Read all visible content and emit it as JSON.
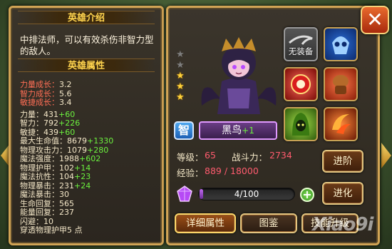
{
  "hero_info": {
    "intro_title": "英雄介绍",
    "description": "中排法师，可以有效杀伤非智力型的敌人。",
    "attr_title": "英雄属性",
    "growth": [
      {
        "label": "力量成长：",
        "value": "3.2"
      },
      {
        "label": "智力成长：",
        "value": "5.6"
      },
      {
        "label": "敏捷成长：",
        "value": "3.4"
      }
    ],
    "stats": [
      {
        "label": "力量：",
        "value": "431",
        "bonus": "+60"
      },
      {
        "label": "智力：",
        "value": "792",
        "bonus": "+226"
      },
      {
        "label": "敏捷：",
        "value": "439",
        "bonus": "+60"
      },
      {
        "label": "最大生命值：",
        "value": "8679",
        "bonus": "+1330"
      },
      {
        "label": "物理攻击力：",
        "value": "1079",
        "bonus": "+280"
      },
      {
        "label": "魔法强度：",
        "value": "1988",
        "bonus": "+602"
      },
      {
        "label": "物理护甲：",
        "value": "102",
        "bonus": "+14"
      },
      {
        "label": "魔法抗性：",
        "value": "104",
        "bonus": "+23"
      },
      {
        "label": "物理暴击：",
        "value": "231",
        "bonus": "+24"
      },
      {
        "label": "魔法暴击：",
        "value": "30",
        "bonus": ""
      },
      {
        "label": "生命回复：",
        "value": "565",
        "bonus": ""
      },
      {
        "label": "能量回复：",
        "value": "237",
        "bonus": ""
      },
      {
        "label": "闪避：",
        "value": "10",
        "bonus": ""
      },
      {
        "label": "穿透物理护甲",
        "value": "5 点",
        "bonus": ""
      }
    ]
  },
  "hero": {
    "star_count": 3,
    "star_total": 5,
    "type_badge": "智",
    "name": "黑鸟",
    "name_plus": "+1",
    "level_label": "等级：",
    "level": "65",
    "power_label": "战斗力：",
    "power": "2734",
    "exp_label": "经验：",
    "exp": "889 / 18000"
  },
  "equipment": {
    "empty_label": "无装备",
    "slots": [
      "empty-slot",
      "blue-skull-mask",
      "red-orb",
      "leather-gauntlet",
      "green-hood",
      "fire-crescent"
    ]
  },
  "soulstones": {
    "progress_text": "4/100",
    "progress": 0.04
  },
  "buttons": {
    "advance": "进阶",
    "evolve": "进化",
    "details": "详细属性",
    "handbook": "图鉴",
    "skills": "技能升级"
  },
  "watermark": "Xiao9i",
  "colors": {
    "accent_gold": "#d1a455",
    "bonus_green": "#6cf23f",
    "growth_red": "#ff6e55",
    "value_red": "#ff5b6e"
  }
}
